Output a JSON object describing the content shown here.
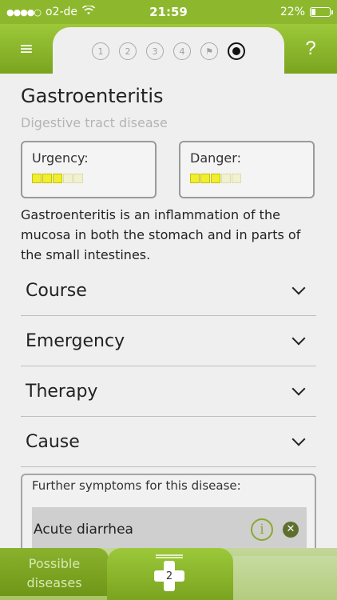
{
  "status_bar": {
    "carrier": "o2-de",
    "time": "21:59",
    "battery": "22%",
    "battery_level": 0.22,
    "signal_icon": "signal-dots-icon",
    "wifi_icon": "wifi-icon"
  },
  "header": {
    "menu_icon": "≡",
    "help_label": "?",
    "steps": [
      "1",
      "2",
      "3",
      "4",
      "⚑",
      ""
    ],
    "active_step": 6
  },
  "disease": {
    "title": "Gastroenteritis",
    "subtitle": "Digestive tract disease",
    "urgency_label": "Urgency:",
    "urgency_level": 3,
    "danger_label": "Danger:",
    "danger_level": 3,
    "max_level": 5,
    "description": "Gastroenteritis is an inflammation of the mucosa in both the stomach and in parts of the small intestines."
  },
  "sections": [
    {
      "label": "Course"
    },
    {
      "label": "Emergency"
    },
    {
      "label": "Therapy"
    },
    {
      "label": "Cause"
    }
  ],
  "symptoms": {
    "header": "Further symptoms for this disease:",
    "items": [
      {
        "label": "Acute diarrhea",
        "info_icon": "i",
        "remove_icon": "✕"
      }
    ]
  },
  "bottom_nav": {
    "left_label_line1": "Possible",
    "left_label_line2": "diseases",
    "center_count": "2"
  },
  "colors": {
    "brand_green": "#8db82e",
    "level_yellow": "#f1ef2d",
    "info_green": "#8aa931"
  }
}
